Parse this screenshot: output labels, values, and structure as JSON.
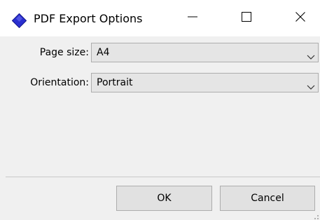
{
  "window": {
    "title": "PDF Export Options",
    "title_icon": "diamond-app-icon",
    "controls": [
      "minimize-icon",
      "maximize-icon",
      "close-icon"
    ]
  },
  "form": {
    "page_size": {
      "label": "Page size:",
      "value": "A4"
    },
    "orientation": {
      "label": "Orientation:",
      "value": "Portrait"
    }
  },
  "buttons": {
    "ok_label": "OK",
    "cancel_label": "Cancel"
  },
  "colors": {
    "app_icon": "#2a2fd0",
    "window_bg": "#f0f0f0",
    "titlebar_bg": "#ffffff"
  }
}
